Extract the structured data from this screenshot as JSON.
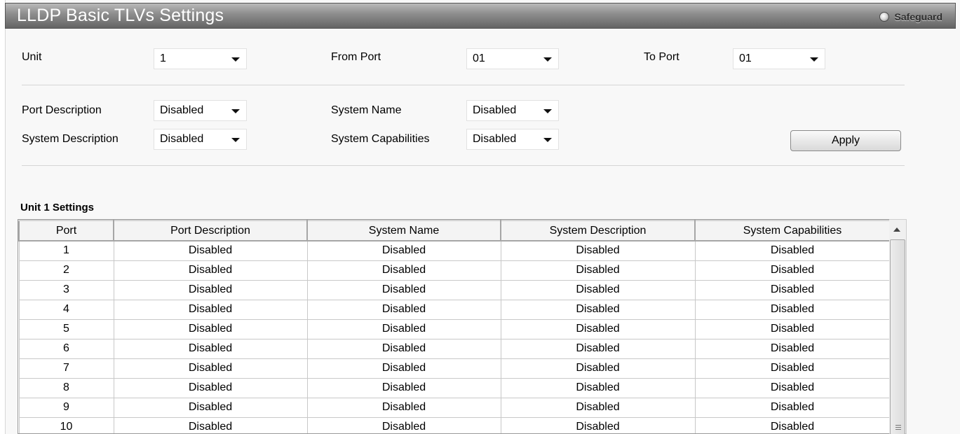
{
  "window": {
    "title": "LLDP Basic TLVs Settings",
    "safeguard_label": "Safeguard"
  },
  "filters": {
    "unit_label": "Unit",
    "unit_value": "1",
    "from_port_label": "From Port",
    "from_port_value": "01",
    "to_port_label": "To Port",
    "to_port_value": "01"
  },
  "tlvs": {
    "port_description_label": "Port Description",
    "port_description_value": "Disabled",
    "system_name_label": "System Name",
    "system_name_value": "Disabled",
    "system_description_label": "System Description",
    "system_description_value": "Disabled",
    "system_capabilities_label": "System Capabilities",
    "system_capabilities_value": "Disabled",
    "apply_label": "Apply"
  },
  "table": {
    "title": "Unit 1 Settings",
    "columns": [
      "Port",
      "Port Description",
      "System Name",
      "System Description",
      "System Capabilities"
    ],
    "rows": [
      [
        "1",
        "Disabled",
        "Disabled",
        "Disabled",
        "Disabled"
      ],
      [
        "2",
        "Disabled",
        "Disabled",
        "Disabled",
        "Disabled"
      ],
      [
        "3",
        "Disabled",
        "Disabled",
        "Disabled",
        "Disabled"
      ],
      [
        "4",
        "Disabled",
        "Disabled",
        "Disabled",
        "Disabled"
      ],
      [
        "5",
        "Disabled",
        "Disabled",
        "Disabled",
        "Disabled"
      ],
      [
        "6",
        "Disabled",
        "Disabled",
        "Disabled",
        "Disabled"
      ],
      [
        "7",
        "Disabled",
        "Disabled",
        "Disabled",
        "Disabled"
      ],
      [
        "8",
        "Disabled",
        "Disabled",
        "Disabled",
        "Disabled"
      ],
      [
        "9",
        "Disabled",
        "Disabled",
        "Disabled",
        "Disabled"
      ],
      [
        "10",
        "Disabled",
        "Disabled",
        "Disabled",
        "Disabled"
      ]
    ]
  },
  "icons": {
    "safeguard": "safeguard-status-icon",
    "dropdown": "chevron-down-icon",
    "scroll_up": "scroll-up-arrow-icon"
  }
}
